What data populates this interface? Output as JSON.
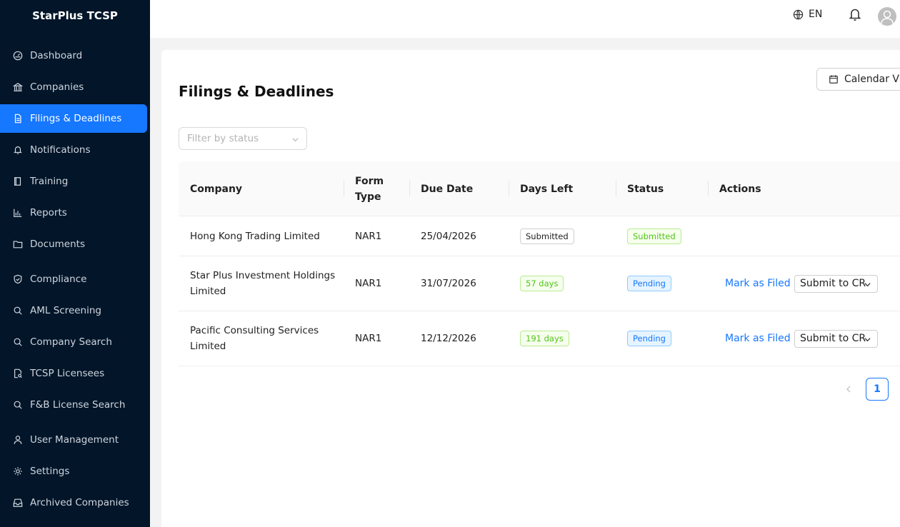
{
  "app": {
    "brand": "StarPlus TCSP"
  },
  "sidebar": {
    "items": [
      {
        "label": "Dashboard",
        "icon": "dashboard-icon"
      },
      {
        "label": "Companies",
        "icon": "bank-icon"
      },
      {
        "label": "Filings & Deadlines",
        "icon": "file-icon",
        "active": true
      },
      {
        "label": "Notifications",
        "icon": "bell-icon"
      },
      {
        "label": "Training",
        "icon": "book-icon"
      },
      {
        "label": "Reports",
        "icon": "bar-chart-icon"
      },
      {
        "label": "Documents",
        "icon": "folder-icon"
      },
      {
        "label": "Compliance",
        "icon": "shield-icon"
      },
      {
        "label": "AML Screening",
        "icon": "search-icon"
      },
      {
        "label": "Company Search",
        "icon": "search-icon"
      },
      {
        "label": "TCSP Licensees",
        "icon": "file-search-icon"
      },
      {
        "label": "F&B License Search",
        "icon": "search-icon"
      },
      {
        "label": "User Management",
        "icon": "user-icon"
      },
      {
        "label": "Settings",
        "icon": "gear-icon"
      },
      {
        "label": "Archived Companies",
        "icon": "inbox-icon"
      }
    ]
  },
  "header": {
    "language": "EN"
  },
  "page": {
    "title": "Filings & Deadlines",
    "calendar_button": "Calendar View",
    "filter_placeholder": "Filter by status"
  },
  "table": {
    "headers": {
      "company": "Company",
      "form_type": "Form Type",
      "due_date": "Due Date",
      "days_left": "Days Left",
      "status": "Status",
      "actions": "Actions"
    },
    "rows": [
      {
        "company": "Hong Kong Trading Limited",
        "form_type": "NAR1",
        "due_date": "25/04/2026",
        "days_left": "Submitted",
        "status": "Submitted",
        "mark_filed": "",
        "submit_select": ""
      },
      {
        "company": "Star Plus Investment Holdings Limited",
        "form_type": "NAR1",
        "due_date": "31/07/2026",
        "days_left": "57 days",
        "status": "Pending",
        "mark_filed": "Mark as Filed",
        "submit_select": "Submit to CR"
      },
      {
        "company": "Pacific Consulting Services Limited",
        "form_type": "NAR1",
        "due_date": "12/12/2026",
        "days_left": "191 days",
        "status": "Pending",
        "mark_filed": "Mark as Filed",
        "submit_select": "Submit to CR"
      }
    ]
  },
  "pagination": {
    "current_page": "1"
  },
  "colors": {
    "sidebar_bg": "#021529",
    "accent": "#1677ff",
    "success": "#52c41a"
  }
}
